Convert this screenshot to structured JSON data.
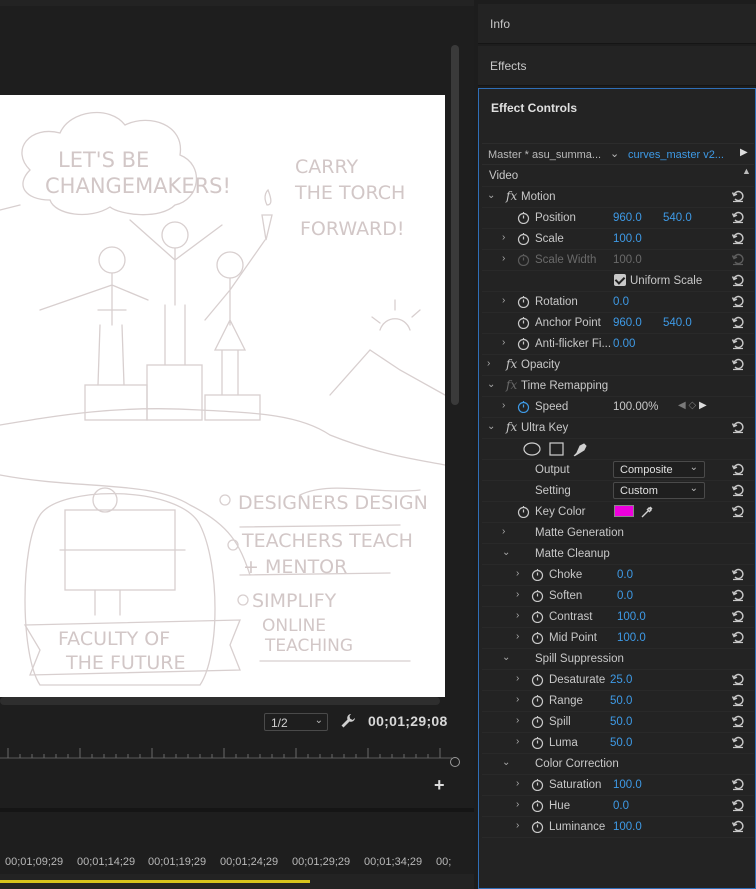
{
  "monitor": {
    "zoom": "1/2",
    "timecode": "00;01;29;08",
    "timeline_times": [
      "00;01;09;29",
      "00;01;14;29",
      "00;01;19;29",
      "00;01;24;29",
      "00;01;29;29",
      "00;01;34;29",
      "00;"
    ]
  },
  "panels": {
    "info": "Info",
    "effects": "Effects",
    "effect_controls": "Effect Controls"
  },
  "source": {
    "master": "Master * asu_summa...",
    "clip": "curves_master v2..."
  },
  "section": "Video",
  "motion": {
    "label": "Motion",
    "position": {
      "label": "Position",
      "x": "960.0",
      "y": "540.0"
    },
    "scale": {
      "label": "Scale",
      "value": "100.0"
    },
    "scale_width": {
      "label": "Scale Width",
      "value": "100.0"
    },
    "uniform_scale": "Uniform Scale",
    "rotation": {
      "label": "Rotation",
      "value": "0.0"
    },
    "anchor_point": {
      "label": "Anchor Point",
      "x": "960.0",
      "y": "540.0"
    },
    "anti_flicker": {
      "label": "Anti-flicker Fi...",
      "value": "0.00"
    }
  },
  "opacity": {
    "label": "Opacity"
  },
  "time_remapping": {
    "label": "Time Remapping",
    "speed": {
      "label": "Speed",
      "value": "100.00%"
    }
  },
  "ultra_key": {
    "label": "Ultra Key",
    "output": {
      "label": "Output",
      "value": "Composite"
    },
    "setting": {
      "label": "Setting",
      "value": "Custom"
    },
    "key_color": {
      "label": "Key Color",
      "color": "#ee00dd"
    },
    "matte_generation": "Matte Generation",
    "matte_cleanup": {
      "label": "Matte Cleanup",
      "choke": {
        "label": "Choke",
        "value": "0.0"
      },
      "soften": {
        "label": "Soften",
        "value": "0.0"
      },
      "contrast": {
        "label": "Contrast",
        "value": "100.0"
      },
      "mid_point": {
        "label": "Mid Point",
        "value": "100.0"
      }
    },
    "spill_suppression": {
      "label": "Spill Suppression",
      "desaturate": {
        "label": "Desaturate",
        "value": "25.0"
      },
      "range": {
        "label": "Range",
        "value": "50.0"
      },
      "spill": {
        "label": "Spill",
        "value": "50.0"
      },
      "luma": {
        "label": "Luma",
        "value": "50.0"
      }
    },
    "color_correction": {
      "label": "Color Correction",
      "saturation": {
        "label": "Saturation",
        "value": "100.0"
      },
      "hue": {
        "label": "Hue",
        "value": "0.0"
      },
      "luminance": {
        "label": "Luminance",
        "value": "100.0"
      }
    }
  },
  "sketch": {
    "title": "LET'S BE CHANGEMAKERS!",
    "torch": "CARRY THE TORCH FORWARD!",
    "bullet1": "DESIGNERS DESIGN",
    "bullet2a": "TEACHERS TEACH",
    "bullet2b": "+ MENTOR",
    "bullet3a": "SIMPLIFY",
    "bullet3b": "ONLINE",
    "bullet3c": "TEACHING",
    "banner1": "FACULTY OF",
    "banner2": "THE FUTURE"
  },
  "colors": {
    "accent": "#3e9ae6",
    "panel_border": "#2f6fb8",
    "playhead_bar": "#d6c21c"
  }
}
